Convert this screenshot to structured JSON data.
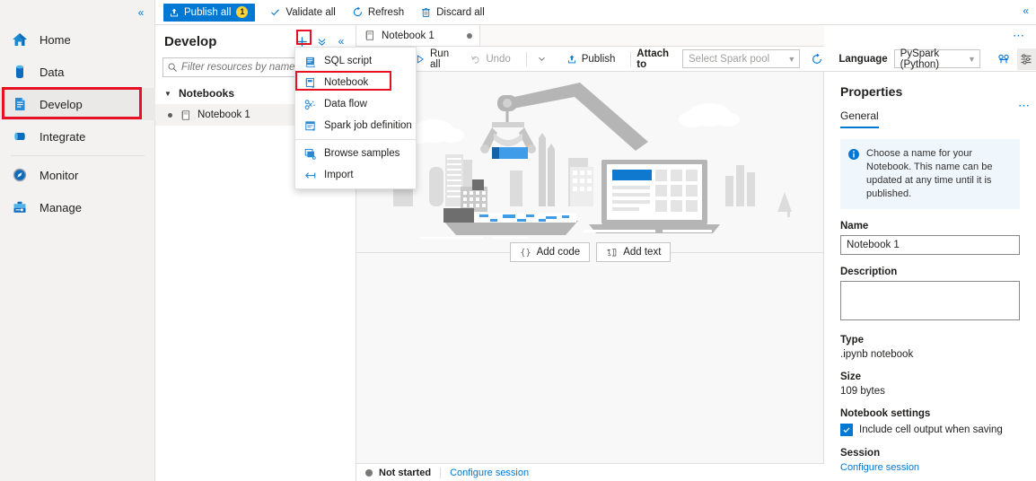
{
  "rail": {
    "collapse_icon": "chevron-double-left-icon",
    "items": [
      {
        "label": "Home",
        "icon": "home-icon",
        "active": false
      },
      {
        "label": "Data",
        "icon": "database-icon",
        "active": false
      },
      {
        "label": "Develop",
        "icon": "document-icon",
        "active": true
      },
      {
        "label": "Integrate",
        "icon": "pipeline-icon",
        "active": false
      },
      {
        "label": "Monitor",
        "icon": "gauge-icon",
        "active": false
      },
      {
        "label": "Manage",
        "icon": "toolbox-icon",
        "active": false
      }
    ]
  },
  "top_bar": {
    "publish_all": "Publish all",
    "publish_count": "1",
    "validate_all": "Validate all",
    "refresh": "Refresh",
    "discard_all": "Discard all",
    "collapse_icon": "chevron-double-left-icon"
  },
  "explorer": {
    "title": "Develop",
    "new_icon": "plus-icon",
    "actions_icon": "chevron-double-down-icon",
    "collapse_icon": "chevron-double-left-icon",
    "filter_placeholder": "Filter resources by name",
    "filter_value": "",
    "groups": [
      {
        "label": "Notebooks",
        "items": [
          {
            "label": "Notebook 1",
            "unsaved": true
          }
        ]
      }
    ]
  },
  "new_menu": {
    "items": [
      {
        "label": "SQL script",
        "icon": "sql-script-icon",
        "highlighted": false,
        "separator_after": false
      },
      {
        "label": "Notebook",
        "icon": "notebook-icon",
        "highlighted": true,
        "separator_after": false
      },
      {
        "label": "Data flow",
        "icon": "data-flow-icon",
        "highlighted": false,
        "separator_after": false
      },
      {
        "label": "Spark job definition",
        "icon": "spark-job-icon",
        "highlighted": false,
        "separator_after": true
      },
      {
        "label": "Browse samples",
        "icon": "browse-samples-icon",
        "highlighted": false,
        "separator_after": false
      },
      {
        "label": "Import",
        "icon": "import-icon",
        "highlighted": false,
        "separator_after": false
      }
    ]
  },
  "tabstrip": {
    "tabs": [
      {
        "label": "Notebook 1",
        "icon": "notebook-icon",
        "dirty": true,
        "active": true
      }
    ]
  },
  "nb_toolbar": {
    "run_all": "Run all",
    "undo": "Undo",
    "undo_chevron": "chevron-down-icon",
    "publish": "Publish",
    "attach_to_label": "Attach to",
    "spark_pool_placeholder": "Select Spark pool",
    "spark_pool_value": "",
    "refresh_icon": "refresh-icon",
    "language_label": "Language",
    "language_value": "PySpark (Python)",
    "view_icon": "outline-icon",
    "settings_icon": "sliders-icon",
    "more_icon": "ellipsis-icon"
  },
  "canvas": {
    "add_code": "Add code",
    "add_text": "Add text",
    "add_code_icon": "braces-icon",
    "add_text_icon": "text-box-icon"
  },
  "status_bar": {
    "status": "Not started",
    "configure_session": "Configure session"
  },
  "properties": {
    "title": "Properties",
    "tab": "General",
    "kebab_icon": "ellipsis-icon",
    "info_icon": "info-icon",
    "info_text": "Choose a name for your Notebook. This name can be updated at any time until it is published.",
    "name_label": "Name",
    "name_value": "Notebook 1",
    "description_label": "Description",
    "description_value": "",
    "type_label": "Type",
    "type_value": ".ipynb notebook",
    "size_label": "Size",
    "size_value": "109 bytes",
    "settings_label": "Notebook settings",
    "include_output_label": "Include cell output when saving",
    "include_output_checked": true,
    "session_label": "Session",
    "configure_session": "Configure session"
  },
  "colors": {
    "accent": "#0078d4",
    "highlight_red": "#e81123",
    "badge_yellow": "#ffd335",
    "info_bg": "#eff6fc"
  }
}
